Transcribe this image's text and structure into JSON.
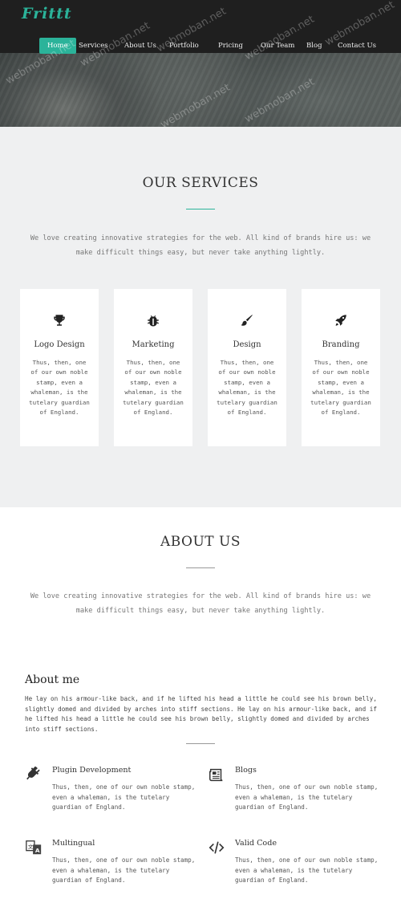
{
  "brand": {
    "logo": "Frittt",
    "accent": "#2bb39a"
  },
  "nav": {
    "items": [
      {
        "label": "Home",
        "active": true
      },
      {
        "label": "Services"
      },
      {
        "label": "About Us"
      },
      {
        "label": "Portfolio"
      },
      {
        "label": "Pricing"
      },
      {
        "label": "Our Team"
      },
      {
        "label": "Blog"
      },
      {
        "label": "Contact Us"
      }
    ]
  },
  "watermark": "webmoban.net",
  "services": {
    "title": "OUR SERVICES",
    "intro": "We love creating innovative strategies for the web. All kind of brands hire us: we make difficult things easy, but never take anything lightly.",
    "cards": [
      {
        "icon": "trophy-icon",
        "title": "Logo Design",
        "description": "Thus, then, one of our own noble stamp, even a whaleman, is the tutelary guardian of England."
      },
      {
        "icon": "bug-icon",
        "title": "Marketing",
        "description": "Thus, then, one of our own noble stamp, even a whaleman, is the tutelary guardian of England."
      },
      {
        "icon": "paintbrush-icon",
        "title": "Design",
        "description": "Thus, then, one of our own noble stamp, even a whaleman, is the tutelary guardian of England."
      },
      {
        "icon": "rocket-icon",
        "title": "Branding",
        "description": "Thus, then, one of our own noble stamp, even a whaleman, is the tutelary guardian of England."
      }
    ]
  },
  "about": {
    "title": "ABOUT US",
    "intro": "We love creating innovative strategies for the web. All kind of brands hire us: we make difficult things easy, but never take anything lightly.",
    "me_title": "About me",
    "me_text": "He lay on his armour-like back, and if he lifted his head a little he could see his brown belly, slightly domed and divided by arches into stiff sections. He lay on his armour-like back, and if he lifted his head a little he could see his brown belly, slightly domed and divided by arches into stiff sections.",
    "features": [
      {
        "icon": "plug-icon",
        "title": "Plugin Development",
        "description": "Thus, then, one of our own noble stamp, even a whaleman, is the tutelary guardian of England."
      },
      {
        "icon": "newspaper-icon",
        "title": "Blogs",
        "description": "Thus, then, one of our own noble stamp, even a whaleman, is the tutelary guardian of England."
      },
      {
        "icon": "translate-icon",
        "title": "Multingual",
        "description": "Thus, then, one of our own noble stamp, even a whaleman, is the tutelary guardian of England."
      },
      {
        "icon": "code-icon",
        "title": "Valid Code",
        "description": "Thus, then, one of our own noble stamp, even a whaleman, is the tutelary guardian of England."
      }
    ]
  }
}
